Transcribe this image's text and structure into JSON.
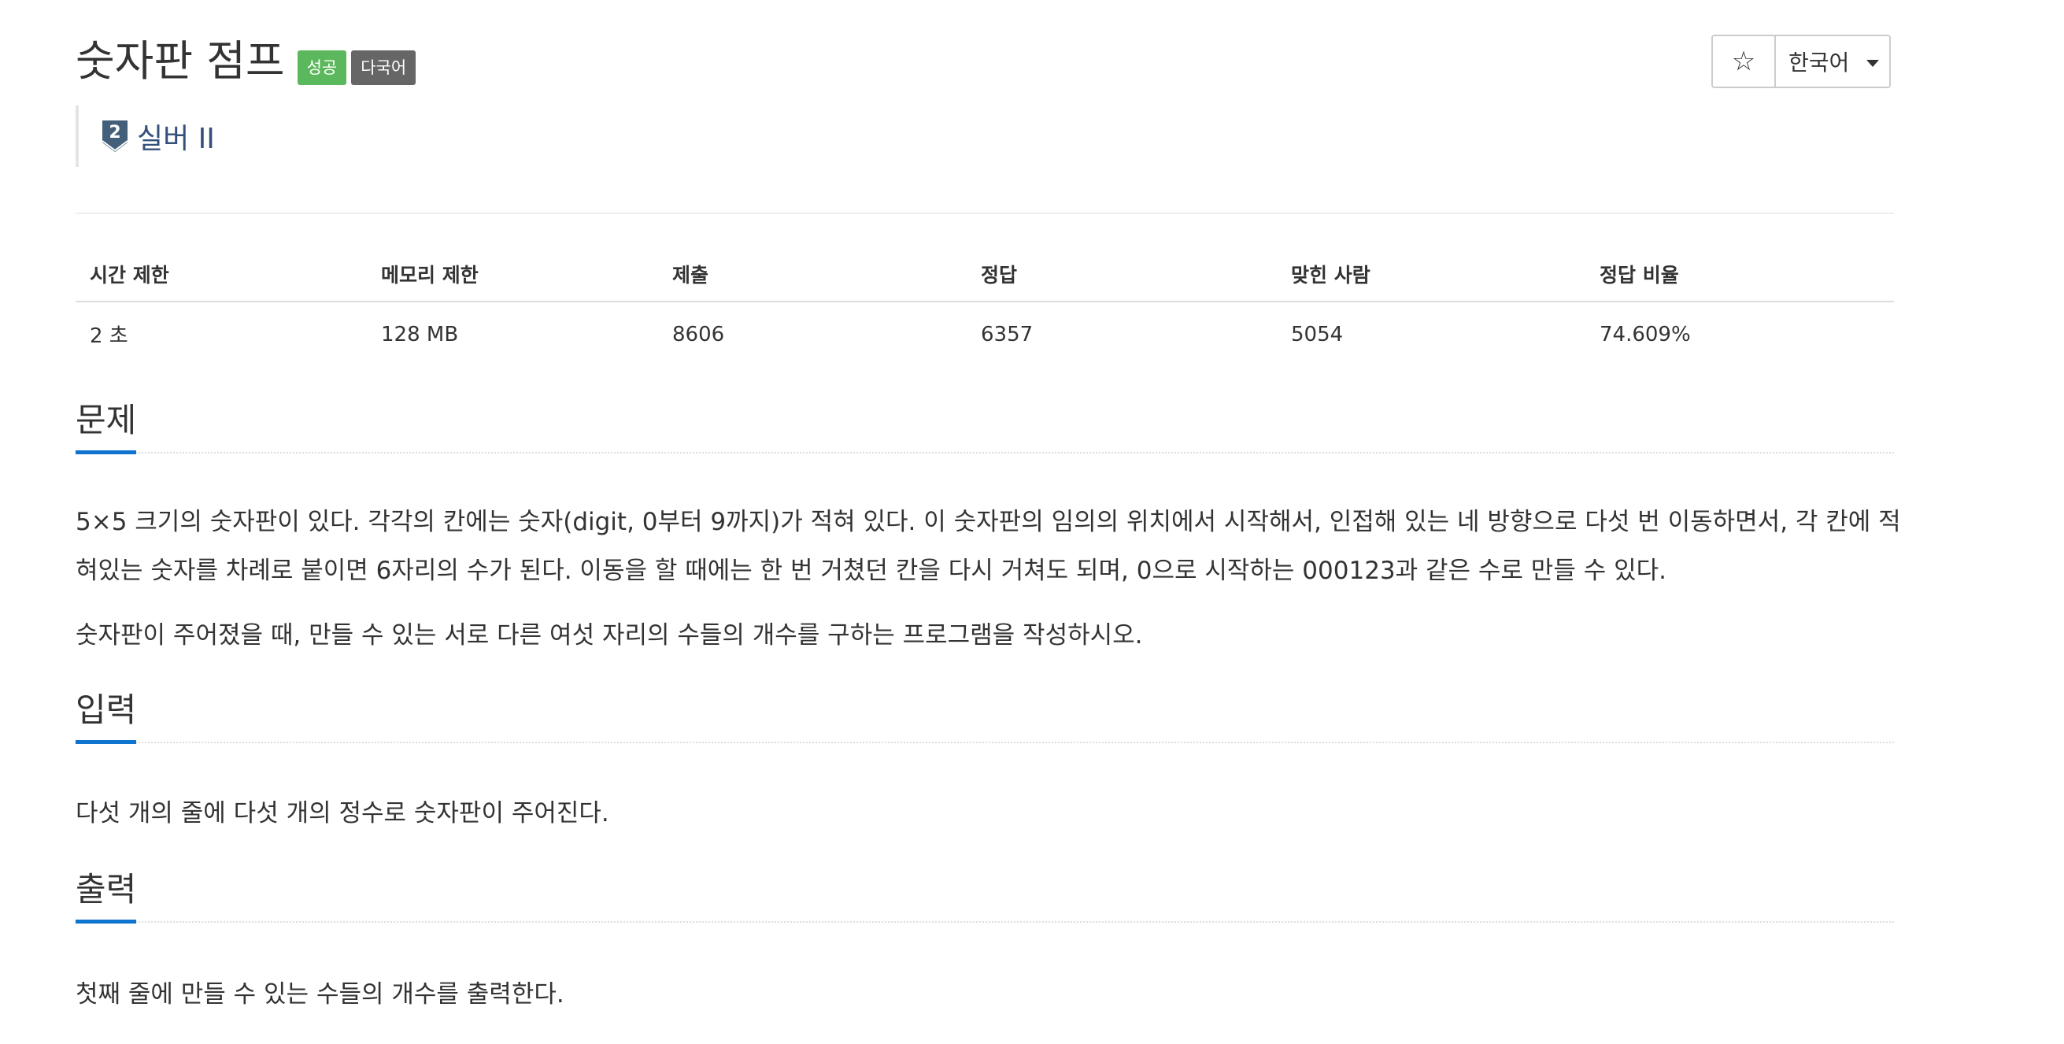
{
  "header": {
    "title": "숫자판 점프",
    "badges": {
      "success": "성공",
      "multilang": "다국어"
    },
    "tier": {
      "level": "2",
      "label": "실버 II"
    },
    "actions": {
      "star_icon": "☆",
      "language": "한국어"
    }
  },
  "info_table": {
    "headers": [
      "시간 제한",
      "메모리 제한",
      "제출",
      "정답",
      "맞힌 사람",
      "정답 비율"
    ],
    "values": [
      "2 초",
      "128 MB",
      "8606",
      "6357",
      "5054",
      "74.609%"
    ]
  },
  "sections": {
    "problem": {
      "heading": "문제",
      "paragraphs": [
        "5×5 크기의 숫자판이 있다. 각각의 칸에는 숫자(digit, 0부터 9까지)가 적혀 있다. 이 숫자판의 임의의 위치에서 시작해서, 인접해 있는 네 방향으로 다섯 번 이동하면서, 각 칸에 적혀있는 숫자를 차례로 붙이면 6자리의 수가 된다. 이동을 할 때에는 한 번 거쳤던 칸을 다시 거쳐도 되며, 0으로 시작하는 000123과 같은 수로 만들 수 있다.",
        "숫자판이 주어졌을 때, 만들 수 있는 서로 다른 여섯 자리의 수들의 개수를 구하는 프로그램을 작성하시오."
      ]
    },
    "input": {
      "heading": "입력",
      "paragraphs": [
        "다섯 개의 줄에 다섯 개의 정수로 숫자판이 주어진다."
      ]
    },
    "output": {
      "heading": "출력",
      "paragraphs": [
        "첫째 줄에 만들 수 있는 수들의 개수를 출력한다."
      ]
    }
  },
  "colors": {
    "success_badge": "#5cb85c",
    "multilang_badge": "#666666",
    "tier_text": "#344f79",
    "section_underline": "#0e74cf"
  }
}
